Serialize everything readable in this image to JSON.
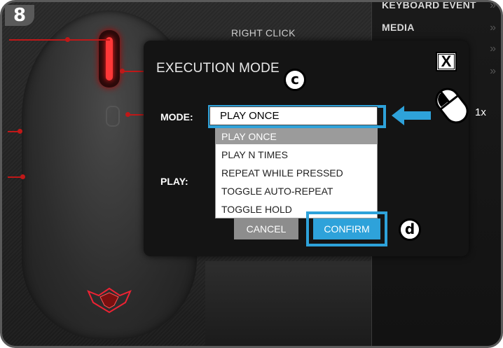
{
  "step": "8",
  "background": {
    "right_click_label": "RIGHT CLICK",
    "menu": [
      {
        "label": "KEYBOARD EVENT"
      },
      {
        "label": "MEDIA"
      }
    ]
  },
  "dialog": {
    "title": "EXECUTION MODE",
    "close_label": "X",
    "mode_label": "MODE:",
    "play_label": "PLAY:",
    "mode_value": "PLAY ONCE",
    "options": [
      "PLAY ONCE",
      "PLAY N TIMES",
      "REPEAT WHILE PRESSED",
      "TOGGLE AUTO-REPEAT",
      "TOGGLE HOLD"
    ],
    "cancel_label": "CANCEL",
    "confirm_label": "CONFIRM"
  },
  "annotations": {
    "label_c": "c",
    "label_d": "d",
    "click_count": "1x"
  },
  "colors": {
    "accent": "#2ea2da",
    "callout_red": "#c01818"
  }
}
